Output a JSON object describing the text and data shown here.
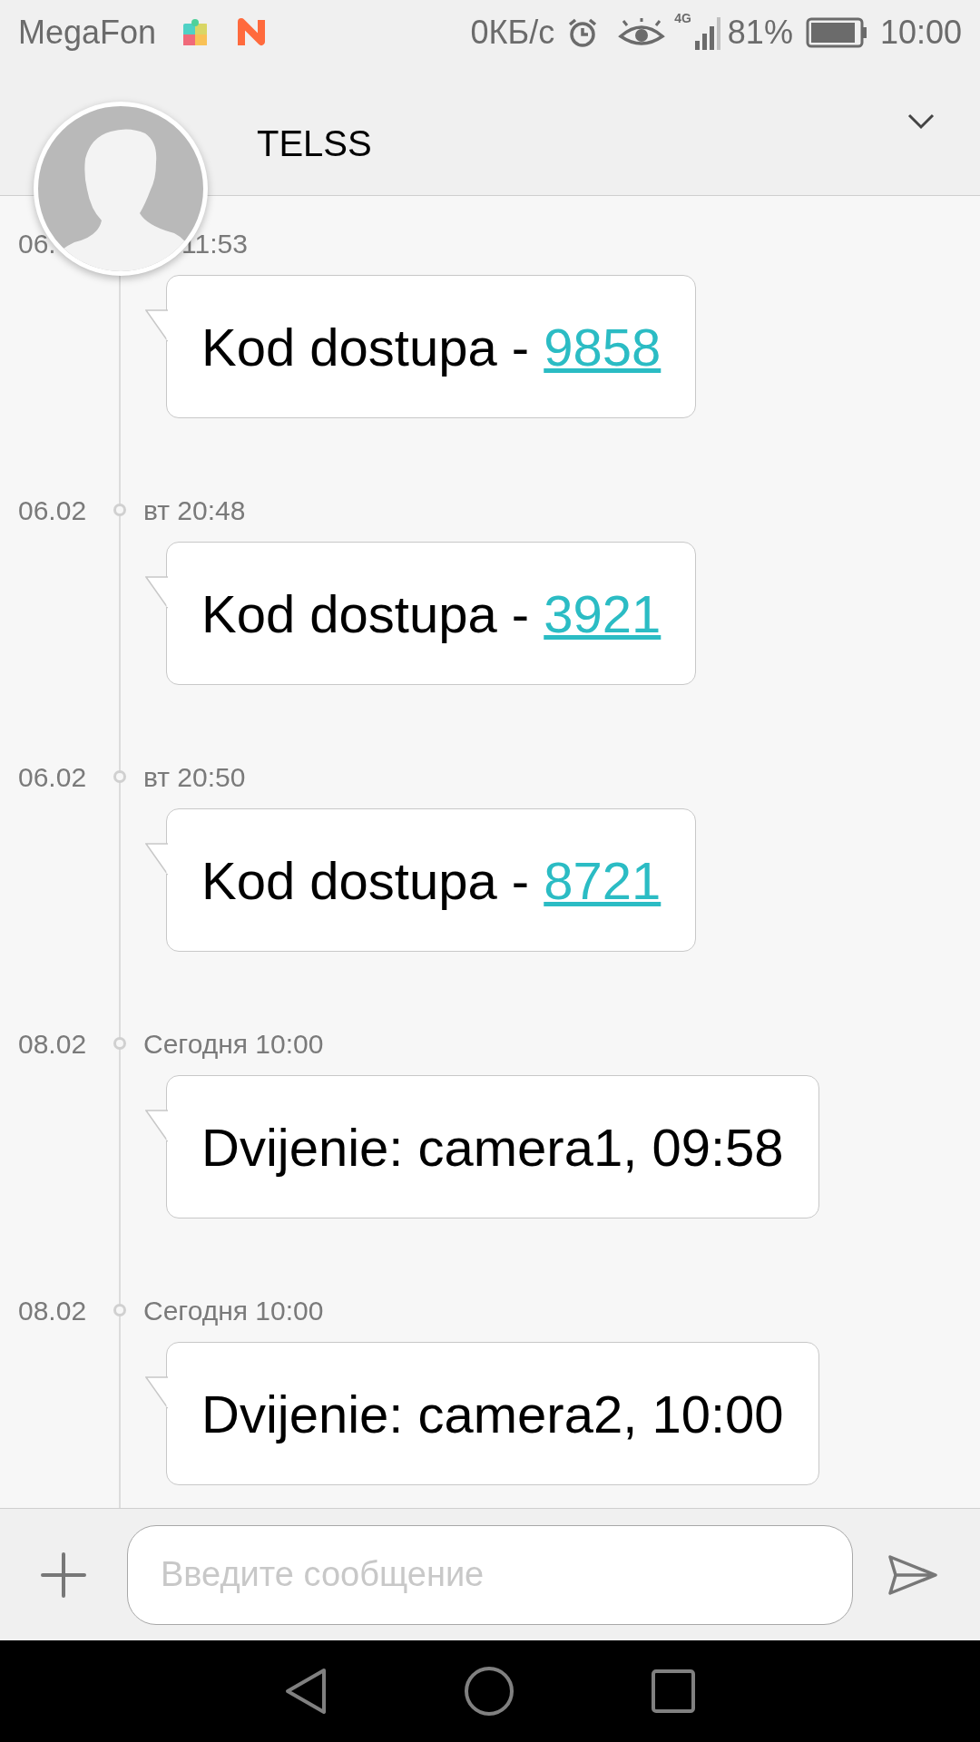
{
  "status_bar": {
    "carrier": "MegaFon",
    "speed": "0КБ/с",
    "network": "4G",
    "battery": "81%",
    "time": "10:00"
  },
  "header": {
    "title": "TELSS"
  },
  "messages": [
    {
      "date": "06.",
      "time": "11:53",
      "covered": true,
      "text": "Kod dostupa - ",
      "link": "9858"
    },
    {
      "date": "06.02",
      "time": "вт 20:48",
      "covered": false,
      "text": "Kod dostupa - ",
      "link": "3921"
    },
    {
      "date": "06.02",
      "time": "вт 20:50",
      "covered": false,
      "text": "Kod dostupa - ",
      "link": "8721"
    },
    {
      "date": "08.02",
      "time": "Сегодня 10:00",
      "covered": false,
      "text": "Dvijenie: camera1, 09:58"
    },
    {
      "date": "08.02",
      "time": "Сегодня 10:00",
      "covered": false,
      "text": "Dvijenie: camera2, 10:00"
    }
  ],
  "composer": {
    "placeholder": "Введите сообщение"
  }
}
